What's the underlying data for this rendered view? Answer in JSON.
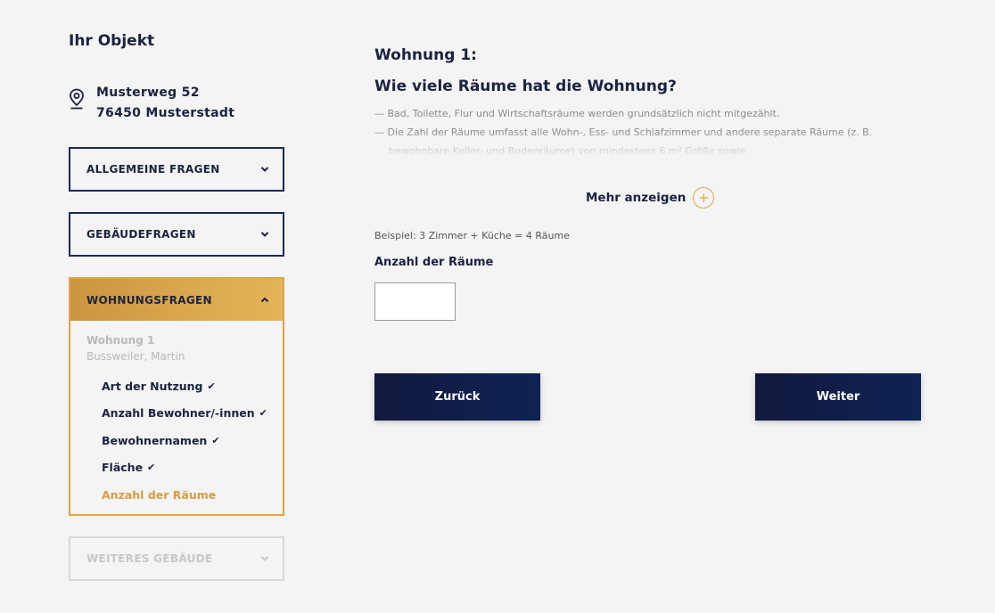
{
  "sidebar": {
    "title": "Ihr Objekt",
    "address_line1": "Musterweg 52",
    "address_line2": "76450 Musterstadt",
    "sections": [
      {
        "label": "ALLGEMEINE FRAGEN"
      },
      {
        "label": "GEBÄUDEFRAGEN"
      },
      {
        "label": "WOHNUNGSFRAGEN"
      },
      {
        "label": "WEITERES GEBÄUDE"
      }
    ],
    "unit_label": "Wohnung 1",
    "unit_owner": "Bussweiler, Martin",
    "steps": [
      {
        "label": "Art der Nutzung",
        "check": "✔"
      },
      {
        "label": "Anzahl Bewohner/-innen",
        "check": "✔"
      },
      {
        "label": "Bewohnernamen",
        "check": "✔"
      },
      {
        "label": "Fläche",
        "check": "✔"
      },
      {
        "label": "Anzahl der Räume",
        "check": ""
      }
    ]
  },
  "main": {
    "heading": "Wohnung 1:",
    "question": "Wie viele Räume hat die Wohnung?",
    "hints": [
      "— Bad, Toilette, Flur und Wirtschaftsräume werden grundsätzlich nicht mitgezählt.",
      "— Die Zahl der Räume umfasst alle Wohn-, Ess- und Schlafzimmer und andere separate Räume (z. B. bewohnbare Keller- und Bodenräume) von mindestens 6 m² Größe sowie"
    ],
    "more_label": "Mehr anzeigen",
    "plus_symbol": "+",
    "example": "Beispiel: 3 Zimmer + Küche  = 4 Räume",
    "field_label": "Anzahl der Räume",
    "field_value": "",
    "back_label": "Zurück",
    "next_label": "Weiter"
  },
  "colors": {
    "navy": "#1a2340",
    "gold": "#e0a445",
    "active_step": "#d89b45"
  }
}
